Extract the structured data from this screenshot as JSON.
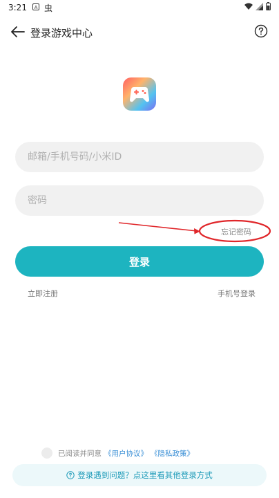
{
  "status_bar": {
    "time": "3:21",
    "icons": [
      "a-box-icon",
      "bug-icon",
      "wifi-icon",
      "signal-icon",
      "battery-icon"
    ]
  },
  "header": {
    "title": "登录游戏中心"
  },
  "login_form": {
    "account_placeholder": "邮箱/手机号码/小米ID",
    "password_placeholder": "密码",
    "forgot_password": "忘记密码",
    "login_button": "登录",
    "register": "立即注册",
    "phone_login": "手机号登录"
  },
  "agreement": {
    "prefix": "已阅读并同意",
    "user_agreement": "《用户协议》",
    "privacy_policy": "《隐私政策》"
  },
  "help_bar": {
    "text": "登录遇到问题？点这里看其他登录方式"
  },
  "colors": {
    "accent": "#1db4c0",
    "link": "#3a8fd6",
    "annotation": "#e0262a"
  }
}
